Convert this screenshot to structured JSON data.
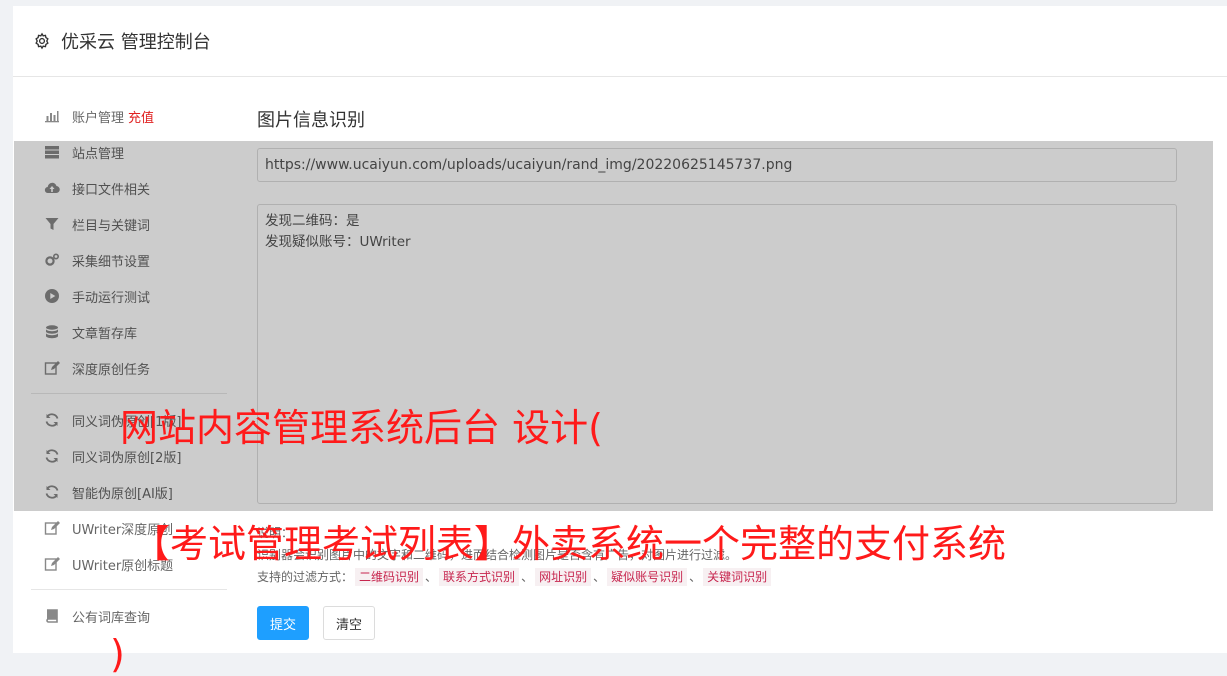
{
  "header": {
    "title": "优采云 管理控制台",
    "icon": "gear-icon"
  },
  "sidebar": {
    "groups": [
      [
        {
          "label": "账户管理",
          "extra": "充值",
          "icon": "bar-chart-icon"
        },
        {
          "label": "站点管理",
          "icon": "server-icon"
        },
        {
          "label": "接口文件相关",
          "icon": "cloud-upload-icon"
        },
        {
          "label": "栏目与关键词",
          "icon": "filter-icon"
        },
        {
          "label": "采集细节设置",
          "icon": "cogs-icon"
        },
        {
          "label": "手动运行测试",
          "icon": "play-icon"
        },
        {
          "label": "文章暂存库",
          "icon": "database-icon"
        },
        {
          "label": "深度原创任务",
          "icon": "edit-icon"
        }
      ],
      [
        {
          "label": "同义词伪原创[1版]",
          "icon": "refresh-icon"
        },
        {
          "label": "同义词伪原创[2版]",
          "icon": "refresh-icon"
        },
        {
          "label": "智能伪原创[AI版]",
          "icon": "refresh-icon"
        },
        {
          "label": "UWriter深度原创",
          "icon": "edit-icon"
        },
        {
          "label": "UWriter原创标题",
          "icon": "edit-icon"
        }
      ],
      [
        {
          "label": "公有词库查询",
          "icon": "book-icon"
        }
      ]
    ]
  },
  "main": {
    "title": "图片信息识别",
    "url_value": "https://www.ucaiyun.com/uploads/ucaiyun/rand_img/20220625145737.png",
    "result_text": "发现二维码：是\n发现疑似账号：UWriter",
    "notes_title": "说明：",
    "notes_line1": "识别器会识别图片中的文字和二维码，进而结合检测图片是否含有广告，对图片进行过滤。",
    "filters_label": "支持的过滤方式：",
    "filters": [
      "二维码识别",
      "联系方式识别",
      "网址识别",
      "疑似账号识别",
      "关键词识别"
    ],
    "submit_label": "提交",
    "clear_label": "清空"
  },
  "watermark": {
    "line1": "网站内容管理系统后台 设计(",
    "line2": "【考试管理考试列表】外卖系统一个完整的支付系统",
    "line3": ")"
  },
  "colors": {
    "primary": "#1e9fff",
    "accent_red": "#e02020",
    "watermark": "#ff1a1a",
    "tag_text": "#c7254e"
  }
}
